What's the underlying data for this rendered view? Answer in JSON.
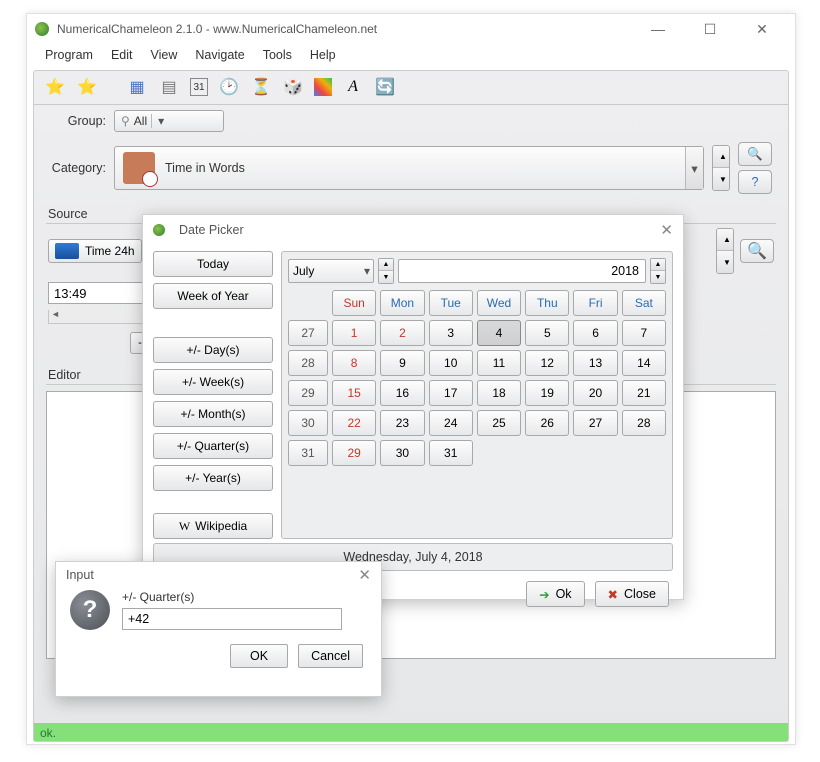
{
  "window": {
    "title": "NumericalChameleon 2.1.0 - www.NumericalChameleon.net"
  },
  "menu": [
    "Program",
    "Edit",
    "View",
    "Navigate",
    "Tools",
    "Help"
  ],
  "toolbar_icons": [
    "star-icon",
    "star-plus-icon",
    "grid-icon",
    "table-icon",
    "calendar-day-icon",
    "clock-icon",
    "hourglass-icon",
    "dice-icon",
    "color-swatch-icon",
    "eraser-icon",
    "refresh-icon"
  ],
  "group": {
    "label": "Group:",
    "value": "All",
    "filter_icon": "filter-icon"
  },
  "category": {
    "label": "Category:",
    "value": "Time in Words"
  },
  "source": {
    "title": "Source",
    "unit": "Time 24h",
    "value": "13:49",
    "neg1": "-1"
  },
  "editor": {
    "title": "Editor"
  },
  "status": "ok.",
  "date_picker": {
    "title": "Date Picker",
    "side": {
      "today": "Today",
      "week_of_year": "Week of Year",
      "pm_days": "+/- Day(s)",
      "pm_weeks": "+/- Week(s)",
      "pm_months": "+/- Month(s)",
      "pm_quarters": "+/- Quarter(s)",
      "pm_years": "+/- Year(s)",
      "wikipedia": "Wikipedia"
    },
    "month": "July",
    "year": "2018",
    "headers": [
      "Sun",
      "Mon",
      "Tue",
      "Wed",
      "Thu",
      "Fri",
      "Sat"
    ],
    "weeks": [
      {
        "num": "27",
        "days": [
          "1",
          "2",
          "3",
          "4",
          "5",
          "6",
          "7"
        ],
        "sunday_idx": 0,
        "red": [
          1
        ]
      },
      {
        "num": "28",
        "days": [
          "8",
          "9",
          "10",
          "11",
          "12",
          "13",
          "14"
        ],
        "sunday_idx": 0
      },
      {
        "num": "29",
        "days": [
          "15",
          "16",
          "17",
          "18",
          "19",
          "20",
          "21"
        ],
        "sunday_idx": 0
      },
      {
        "num": "30",
        "days": [
          "22",
          "23",
          "24",
          "25",
          "26",
          "27",
          "28"
        ],
        "sunday_idx": 0
      },
      {
        "num": "31",
        "days": [
          "29",
          "30",
          "31"
        ],
        "sunday_idx": 0
      }
    ],
    "selected": "4",
    "info": "Wednesday, July 4, 2018",
    "ok": "Ok",
    "close": "Close"
  },
  "input_dialog": {
    "title": "Input",
    "label": "+/- Quarter(s)",
    "value": "+42",
    "ok": "OK",
    "cancel": "Cancel"
  }
}
